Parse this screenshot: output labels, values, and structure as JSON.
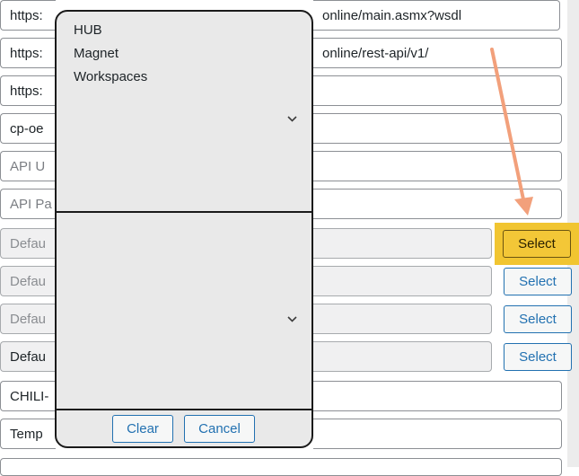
{
  "fields": [
    {
      "left_text": "https:",
      "right_text": "online/main.asmx?wsdl"
    },
    {
      "left_text": "https:",
      "right_text": "online/rest-api/v1/"
    },
    {
      "left_text": "https:",
      "right_text": ""
    },
    {
      "left_text": "cp-oe",
      "right_text": ""
    },
    {
      "left_text": "API U",
      "right_text": ""
    },
    {
      "left_text": "API Pa",
      "right_text": ""
    },
    {
      "left_text": "Defau"
    },
    {
      "left_text": "Defau"
    },
    {
      "left_text": "Defau"
    },
    {
      "left_text": "Defau"
    },
    {
      "left_text": "CHILI-",
      "right_text": ""
    },
    {
      "left_text": "Temp",
      "right_text": ""
    }
  ],
  "select_buttons": [
    "Select",
    "Select",
    "Select",
    "Select"
  ],
  "popup": {
    "options": [
      "HUB",
      "Magnet",
      "Workspaces"
    ],
    "clear_label": "Clear",
    "cancel_label": "Cancel"
  },
  "colors": {
    "annotation_arrow": "#f2a07b",
    "highlight": "#f1c531",
    "accent": "#2271b1"
  }
}
